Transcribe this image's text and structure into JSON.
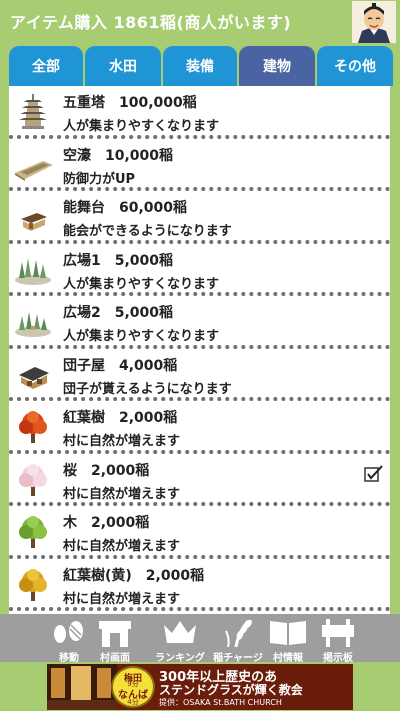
{
  "header": {
    "title": "アイテム購入 1861稲(商人がいます)",
    "avatar_icon": "merchant-avatar-icon"
  },
  "tabs": [
    {
      "label": "全部",
      "active": false
    },
    {
      "label": "水田",
      "active": false
    },
    {
      "label": "装備",
      "active": false
    },
    {
      "label": "建物",
      "active": true
    },
    {
      "label": "その他",
      "active": false
    }
  ],
  "items": [
    {
      "title": "五重塔　100,000稲",
      "desc": "人が集まりやすくなります",
      "icon": "pagoda-icon"
    },
    {
      "title": "空濠　10,000稲",
      "desc": "防御力がUP",
      "icon": "moat-icon"
    },
    {
      "title": "能舞台　60,000稲",
      "desc": "能会ができるようになります",
      "icon": "noh-stage-icon"
    },
    {
      "title": "広場1　5,000稲",
      "desc": "人が集まりやすくなります",
      "icon": "plaza-icon"
    },
    {
      "title": "広場2　5,000稲",
      "desc": "人が集まりやすくなります",
      "icon": "plaza-icon"
    },
    {
      "title": "団子屋　4,000稲",
      "desc": "団子が貰えるようになります",
      "icon": "dango-shop-icon"
    },
    {
      "title": "紅葉樹　2,000稲",
      "desc": "村に自然が増えます",
      "icon": "maple-tree-icon"
    },
    {
      "title": "桜　2,000稲",
      "desc": "村に自然が増えます",
      "icon": "cherry-tree-icon",
      "checked": true
    },
    {
      "title": "木　2,000稲",
      "desc": "村に自然が増えます",
      "icon": "green-tree-icon"
    },
    {
      "title": "紅葉樹(黄)　2,000稲",
      "desc": "村に自然が増えます",
      "icon": "yellow-tree-icon"
    }
  ],
  "nav": [
    {
      "label": "移動",
      "icon": "footprints-icon"
    },
    {
      "label": "村画面",
      "icon": "village-gate-icon"
    },
    {
      "label": "ランキング",
      "icon": "crown-icon"
    },
    {
      "label": "稲チャージ",
      "icon": "rice-plant-icon"
    },
    {
      "label": "村情報",
      "icon": "open-book-icon"
    },
    {
      "label": "掲示板",
      "icon": "notice-board-icon"
    }
  ],
  "ad": {
    "badge_line1": "梅田",
    "badge_line2": "9分",
    "badge_line3": "なんば",
    "badge_line4": "4分",
    "line1": "300年以上歴史のあ",
    "line2": "ステンドグラスが輝く教会",
    "line3": "提供：OSAKA St.BATH CHURCH"
  },
  "colors": {
    "background": "#a7cc72",
    "tab_blue": "#1f95d6",
    "tab_active": "#4a63a2",
    "nav_gray": "#9e9e9e",
    "ad_red": "#6b1d0c"
  }
}
